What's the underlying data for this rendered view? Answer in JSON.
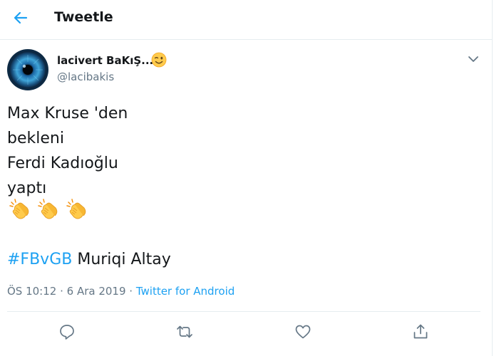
{
  "header": {
    "title": "Tweetle",
    "back_icon": "arrow-left-icon",
    "accent_color": "#1da1f2"
  },
  "author": {
    "display_name": "lacivert BaKıŞ...",
    "name_emoji_icon": "winking-face-icon",
    "handle": "@lacibakis",
    "avatar_icon": "blue-eye-avatar"
  },
  "tweet": {
    "lines": [
      "Max Kruse 'den",
      "bekleni",
      "Ferdi Kadıoğlu",
      "yaptı"
    ],
    "emoji_icons": [
      "clapping-hands-icon",
      "clapping-hands-icon",
      "clapping-hands-icon"
    ],
    "hashtag": "#FBvGB",
    "after_hashtag": " Muriqi Altay"
  },
  "meta": {
    "time": "ÖS 10:12",
    "separator1": " · ",
    "date": "6 Ara 2019",
    "separator2": " · ",
    "source": "Twitter for Android"
  },
  "actions": [
    {
      "name": "reply",
      "icon": "comment-icon"
    },
    {
      "name": "retweet",
      "icon": "retweet-icon"
    },
    {
      "name": "like",
      "icon": "heart-icon"
    },
    {
      "name": "share",
      "icon": "share-icon"
    }
  ],
  "colors": {
    "text": "#14171a",
    "secondary": "#657786",
    "link": "#1da1f2",
    "border": "#e6ecf0"
  }
}
